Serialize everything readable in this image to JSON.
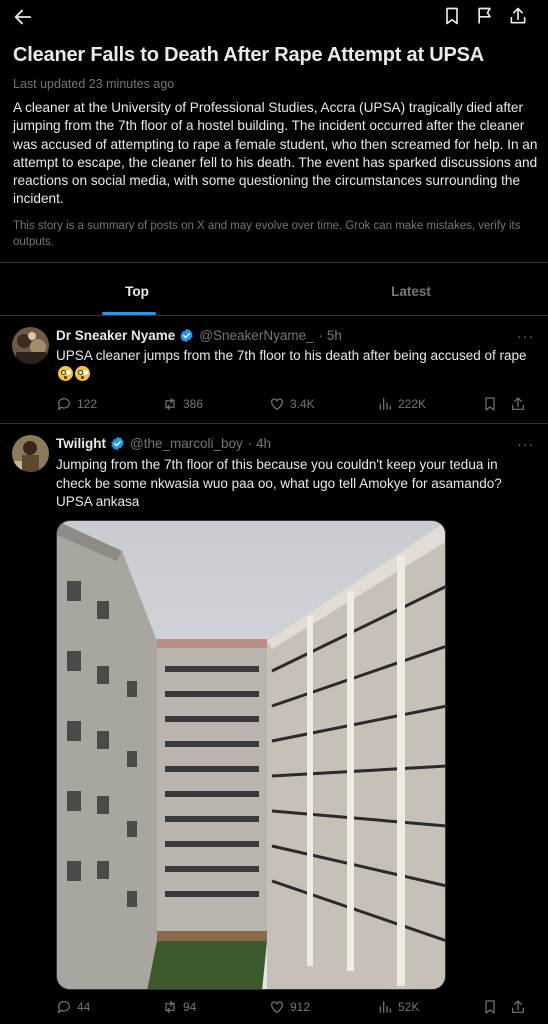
{
  "header": {
    "back_icon": "arrow-left-icon",
    "bookmark_icon": "bookmark-icon",
    "flag_icon": "flag-icon",
    "share_icon": "share-icon"
  },
  "story": {
    "title": "Cleaner Falls to Death After Rape Attempt at UPSA",
    "updated": "Last updated 23 minutes ago",
    "summary": "A cleaner at the University of Professional Studies, Accra (UPSA) tragically died after jumping from the 7th floor of a hostel building. The incident occurred after the cleaner was accused of attempting to rape a female student, who then screamed for help. In an attempt to escape, the cleaner fell to his death. The event has sparked discussions and reactions on social media, with some questioning the circumstances surrounding the incident.",
    "disclaimer": "This story is a summary of posts on X and may evolve over time. Grok can make mistakes, verify its outputs."
  },
  "tabs": [
    {
      "label": "Top",
      "active": true
    },
    {
      "label": "Latest",
      "active": false
    }
  ],
  "posts": [
    {
      "name": "Dr Sneaker Nyame",
      "handle": "@SneakerNyame_",
      "time": "· 5h",
      "text": "UPSA cleaner jumps from the 7th floor to his death after being accused of rape",
      "emojis": "😳😳",
      "replies": "122",
      "reposts": "386",
      "likes": "3.4K",
      "views": "222K"
    },
    {
      "name": "Twilight",
      "handle": "@the_marcoli_boy",
      "time": "· 4h",
      "text": "Jumping from the 7th floor of this because you couldn't keep your tedua in check be some nkwasia wuo paa oo, what ugo tell Amokye for asamando? UPSA ankasa",
      "replies": "44",
      "reposts": "94",
      "likes": "912",
      "views": "52K"
    }
  ],
  "more_label": "···",
  "colors": {
    "background": "#000000",
    "text": "#e7e9ea",
    "muted": "#71767b",
    "accent": "#1d9bf0",
    "divider": "#2f3336"
  }
}
